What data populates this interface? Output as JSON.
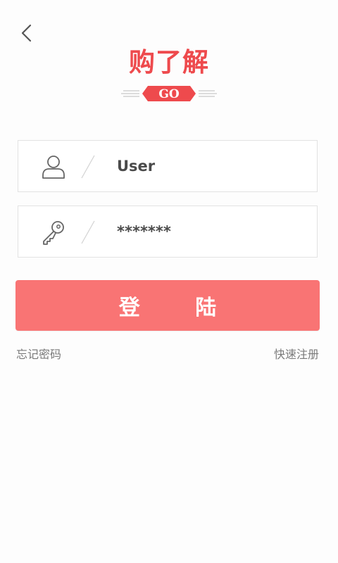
{
  "header": {
    "back_icon": "chevron-left-icon"
  },
  "logo": {
    "title": "购了解",
    "badge": "GO",
    "accent_color": "#ee4a4d"
  },
  "form": {
    "username": {
      "icon": "user-icon",
      "value": "User"
    },
    "password": {
      "icon": "key-icon",
      "value": "*******"
    },
    "login_label": "登 陆",
    "button_color": "#f97474"
  },
  "links": {
    "forgot_password": "忘记密码",
    "quick_register": "快速注册"
  }
}
